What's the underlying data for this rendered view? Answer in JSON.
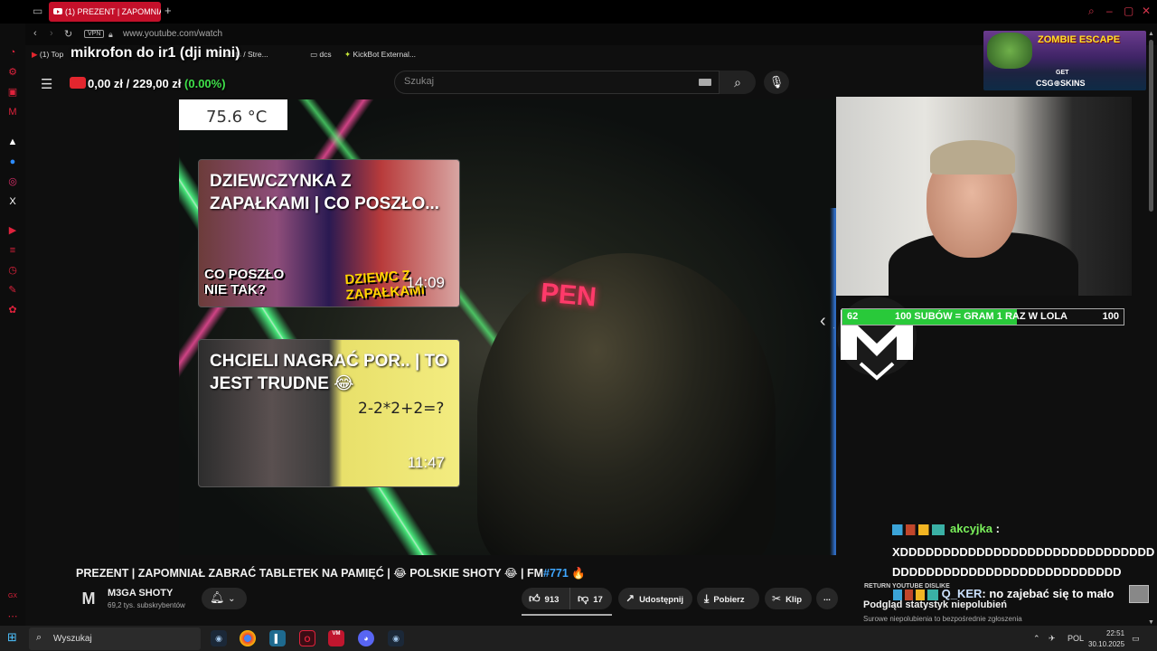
{
  "browser": {
    "tab_title": "(1) PREZENT | ZAPOMNIAŁ",
    "vpn_label": "VPN",
    "url": "www.youtube.com/watch",
    "bookmarks": [
      "(1) Top",
      "Credits / Stre...",
      "dcs",
      "KickBot External..."
    ]
  },
  "youtube": {
    "search_placeholder": "Szukaj"
  },
  "overlay": {
    "mic_text": "mikrofon do ir1 (dji mini)",
    "goal_current": "0,00 zł",
    "goal_separator": "/",
    "goal_target": "229,00 zł",
    "goal_percent": "(0.00%)",
    "temperature": "75.6 °C",
    "neon_sign": "PEN",
    "sub_goal": {
      "current": "62",
      "label": "100 SUBÓW = GRAM 1 RAZ W LOLA",
      "target": "100",
      "progress": 0.62
    },
    "csgo_banner": {
      "title": "ZOMBIE ESCAPE",
      "get": "GET",
      "brand": "CSG⊕SKINS"
    }
  },
  "thumbnails": [
    {
      "title": "DZIEWCZYNKA Z ZAPAŁKAMI | CO POSZŁO...",
      "duration": "14:09",
      "tag_left": "CO POSZŁO NIE TAK?",
      "tag_right": "DZIEWC Z ZAPAŁKAMI"
    },
    {
      "title": "CHCIELI NAGRAĆ POR.. | TO JEST TRUDNE 😂",
      "duration": "11:47",
      "math": "2-2*2+2=?"
    }
  ],
  "chat": {
    "user1": "akcyjka",
    "user1_sep": ":",
    "message1": "XDDDDDDDDDDDDDDDDDDDDDDDDDDDDDDDDDDDDDDDDDDDDDDDDDDDDDDDDD",
    "user2": "Q_KER",
    "message2": ": no zajebać się to mało"
  },
  "video": {
    "title": "PREZENT | ZAPOMNIAŁ ZABRAĆ TABLETEK NA PAMIĘĆ | 😂 POLSKIE SHOTY 😂 | FM",
    "hashtag": "#771",
    "title_emoji": "🔥",
    "channel_name": "M3GA SHOTY",
    "channel_subs": "69,2 tys. subskrybentów",
    "likes": "913",
    "dislikes": "17",
    "share_label": "Udostępnij",
    "download_label": "Pobierz",
    "clip_label": "Klip",
    "more_label": "..."
  },
  "ryd": {
    "tag": "RETURN YOUTUBE DISLIKE",
    "title": "Podgląd statystyk niepolubień",
    "subtitle": "Surowe niepolubienia to bezpośrednie zgłoszenia"
  },
  "taskbar": {
    "search_text": "Wyszukaj",
    "language": "POL",
    "time": "22:51",
    "date": "30.10.2025"
  },
  "colors": {
    "opera_red": "#e0223c",
    "yt_red": "#e3262e",
    "goal_green": "#3fe04a",
    "link_blue": "#3ea6ff"
  }
}
